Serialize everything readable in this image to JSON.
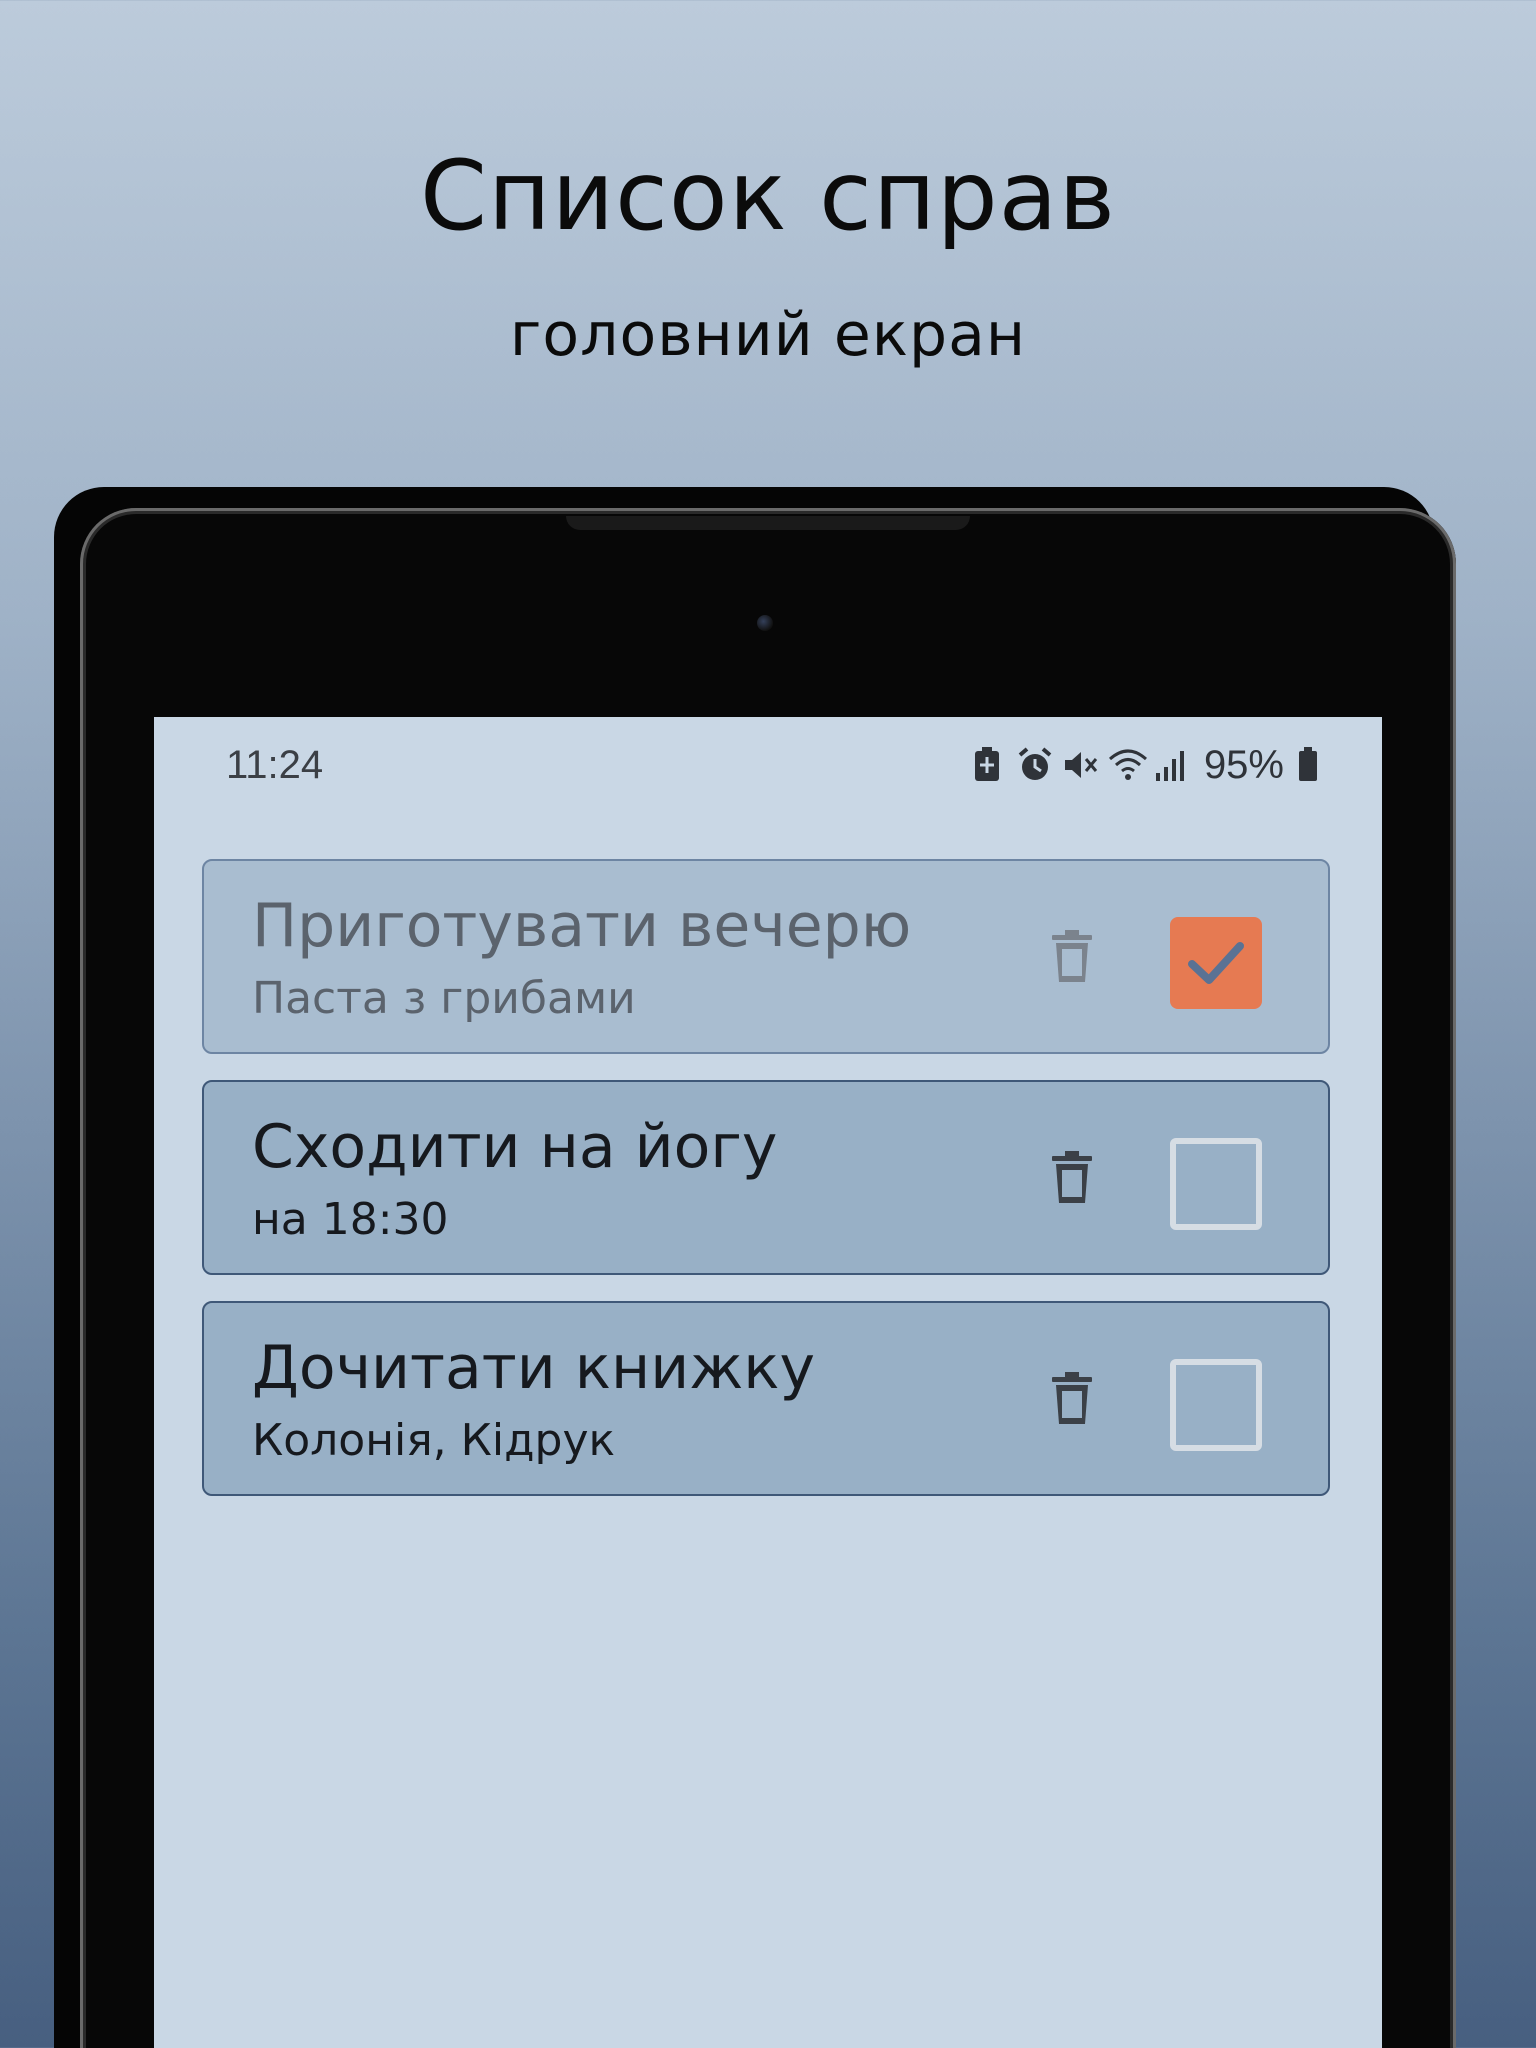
{
  "promo": {
    "title": "Список справ",
    "subtitle": "головний екран"
  },
  "status_bar": {
    "time": "11:24",
    "battery": "95%",
    "icons": [
      "battery-saver-icon",
      "alarm-icon",
      "mute-icon",
      "wifi-icon",
      "signal-icon",
      "battery-icon"
    ]
  },
  "tasks": [
    {
      "title": "Приготувати вечерю",
      "subtitle": "Паста з грибами",
      "done": true
    },
    {
      "title": "Сходити на йогу",
      "subtitle": "на 18:30",
      "done": false
    },
    {
      "title": "Дочитати книжку",
      "subtitle": "Колонія, Кідрук",
      "done": false
    }
  ],
  "colors": {
    "checkbox_checked": "#e67a52",
    "card_background": "#98b0c6",
    "screen_background": "#c9d7e5"
  }
}
